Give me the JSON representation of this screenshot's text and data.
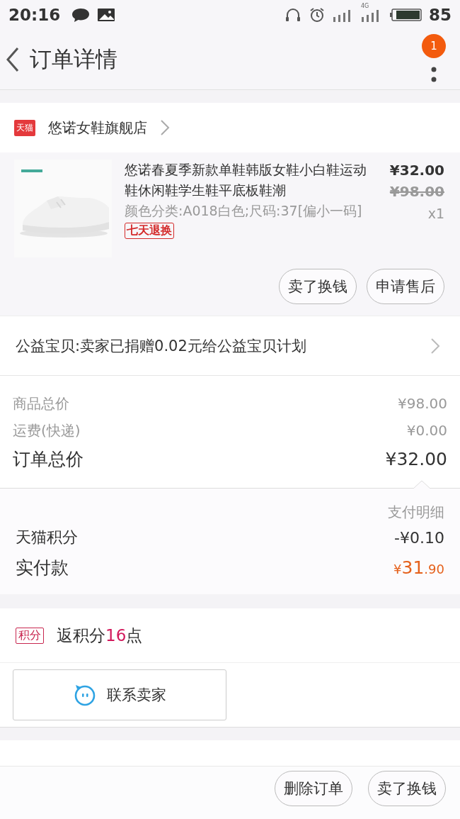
{
  "status_bar": {
    "time": "20:16",
    "network": "4G",
    "battery": "85"
  },
  "header": {
    "title": "订单详情",
    "badge": "1"
  },
  "shop": {
    "tag": "天猫",
    "name": "悠诺女鞋旗舰店"
  },
  "product": {
    "kind": "picture",
    "title": "悠诺春夏季新款单鞋韩版女鞋小白鞋运动鞋休闲鞋学生鞋平底板鞋潮",
    "sku": "颜色分类:A018白色;尺码:37[偏小一码]",
    "service_tag": "七天退换",
    "price": "¥32.00",
    "original_price": "¥98.00",
    "quantity": "x1",
    "buttons": [
      "卖了换钱",
      "申请售后"
    ]
  },
  "charity": {
    "text": "公益宝贝:卖家已捐赠0.02元给公益宝贝计划"
  },
  "summary": [
    {
      "label": "商品总价",
      "value": "¥98.00",
      "kind": "minor"
    },
    {
      "label": "运费(快递)",
      "value": "¥0.00",
      "kind": "minor"
    },
    {
      "label": "订单总价",
      "value": "¥32.00",
      "kind": "major"
    }
  ],
  "payment": {
    "title": "支付明细",
    "rows": [
      {
        "label": "天猫积分",
        "value": "-¥0.10"
      }
    ],
    "paid_label": "实付款",
    "paid_currency": "¥",
    "paid_int": "31",
    "paid_dec": ".90"
  },
  "points": {
    "tag": "积分",
    "prefix": "返积分",
    "value": "16",
    "suffix": "点"
  },
  "contact": {
    "label": "联系卖家"
  },
  "bottom_buttons": [
    "删除订单",
    "卖了换钱"
  ]
}
